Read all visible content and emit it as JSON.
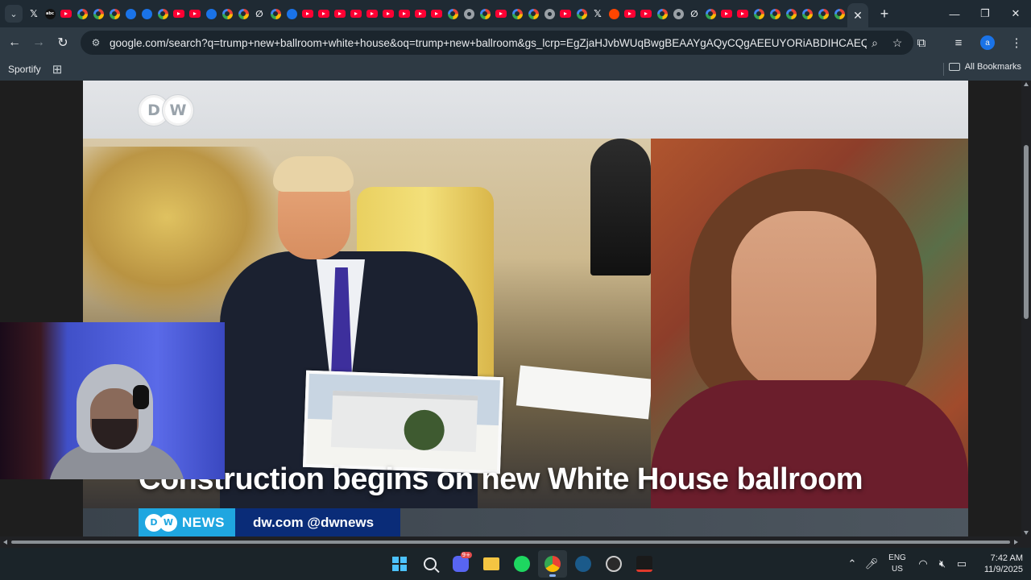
{
  "browser": {
    "tabs": [
      {
        "icon": "x-icon"
      },
      {
        "icon": "abc-icon"
      },
      {
        "icon": "youtube-icon"
      },
      {
        "icon": "google-icon"
      },
      {
        "icon": "google-icon"
      },
      {
        "icon": "google-icon"
      },
      {
        "icon": "site-icon"
      },
      {
        "icon": "site-icon"
      },
      {
        "icon": "google-icon"
      },
      {
        "icon": "youtube-icon"
      },
      {
        "icon": "youtube-icon"
      },
      {
        "icon": "site-icon"
      },
      {
        "icon": "google-icon"
      },
      {
        "icon": "google-icon"
      },
      {
        "icon": "slash-icon"
      },
      {
        "icon": "google-icon"
      },
      {
        "icon": "site-icon"
      },
      {
        "icon": "youtube-icon"
      },
      {
        "icon": "youtube-icon"
      },
      {
        "icon": "youtube-icon"
      },
      {
        "icon": "youtube-icon"
      },
      {
        "icon": "youtube-icon"
      },
      {
        "icon": "youtube-icon"
      },
      {
        "icon": "youtube-icon"
      },
      {
        "icon": "youtube-icon"
      },
      {
        "icon": "youtube-icon"
      },
      {
        "icon": "google-icon"
      },
      {
        "icon": "chrome-icon"
      },
      {
        "icon": "google-icon"
      },
      {
        "icon": "youtube-icon"
      },
      {
        "icon": "google-icon"
      },
      {
        "icon": "google-icon"
      },
      {
        "icon": "chrome-icon"
      },
      {
        "icon": "youtube-icon"
      },
      {
        "icon": "google-icon"
      },
      {
        "icon": "x-icon"
      },
      {
        "icon": "reddit-icon"
      },
      {
        "icon": "youtube-icon"
      },
      {
        "icon": "youtube-icon"
      },
      {
        "icon": "google-icon"
      },
      {
        "icon": "chrome-icon"
      },
      {
        "icon": "slash-icon"
      },
      {
        "icon": "google-icon"
      },
      {
        "icon": "youtube-icon"
      },
      {
        "icon": "youtube-icon"
      },
      {
        "icon": "google-icon"
      },
      {
        "icon": "google-icon"
      },
      {
        "icon": "google-icon"
      },
      {
        "icon": "google-icon"
      },
      {
        "icon": "google-icon"
      },
      {
        "icon": "google-icon"
      }
    ],
    "active_tab_close": "✕",
    "new_tab": "+",
    "window": {
      "minimize": "—",
      "restore": "❐",
      "close": "✕"
    },
    "url": "google.com/search?q=trump+new+ballroom+white+house&oq=trump+new+ballroom&gs_lcrp=EgZjaHJvbWUqBwgBEAAYgAQyCQgAEEUYORiABDIHCAEQABiABDIHCAIQABiABDI...",
    "bookmarks": {
      "items": [
        {
          "label": "Sportify"
        }
      ],
      "all_bookmarks": "All Bookmarks"
    },
    "profile_initial": "a"
  },
  "video": {
    "headline": "Construction begins on new White House ballroom",
    "brand": "DW",
    "lower_third_brand": "NEWS",
    "lower_third_handle": "dw.com @dwnews"
  },
  "taskbar": {
    "language": {
      "line1": "ENG",
      "line2": "US"
    },
    "time": "7:42 AM",
    "date": "11/9/2025",
    "discord_badge": "9+"
  },
  "colors": {
    "accent": "#1fa6e0",
    "dw_dark_blue": "#0a2c78",
    "chrome_bg": "#2e3a44"
  }
}
